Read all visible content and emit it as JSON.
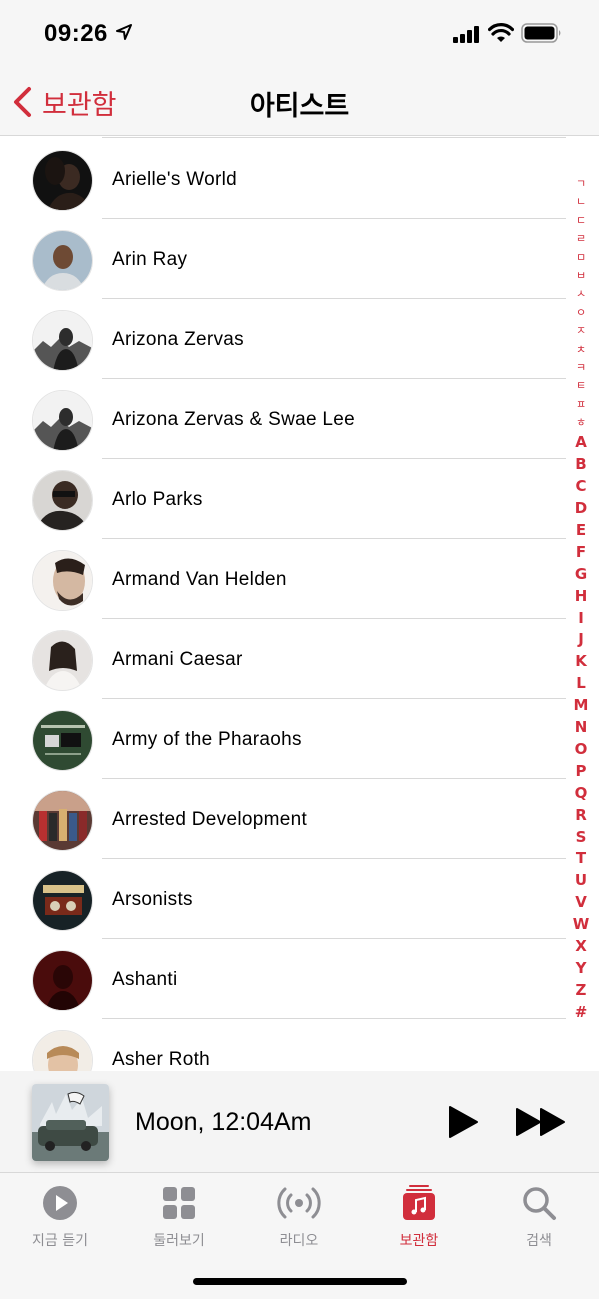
{
  "status": {
    "time": "09:26"
  },
  "nav": {
    "back_label": "보관함",
    "title": "아티스트"
  },
  "artists": [
    {
      "name": "Arielle's World",
      "avatar_color": "#2a2420"
    },
    {
      "name": "Arin Ray",
      "avatar_color": "#9fb3c4"
    },
    {
      "name": "Arizona Zervas",
      "avatar_color": "#6c6c6c"
    },
    {
      "name": "Arizona Zervas & Swae Lee",
      "avatar_color": "#6c6c6c"
    },
    {
      "name": "Arlo Parks",
      "avatar_color": "#3a3633"
    },
    {
      "name": "Armand Van Helden",
      "avatar_color": "#cfc6bd"
    },
    {
      "name": "Armani Caesar",
      "avatar_color": "#d9d4d0"
    },
    {
      "name": "Army of the Pharaohs",
      "avatar_color": "#2d4a30"
    },
    {
      "name": "Arrested Development",
      "avatar_color": "#7a4a3a"
    },
    {
      "name": "Arsonists",
      "avatar_color": "#1f2a2c"
    },
    {
      "name": "Ashanti",
      "avatar_color": "#5a0d0d"
    },
    {
      "name": "Asher Roth",
      "avatar_color": "#e8d8c6"
    }
  ],
  "index": {
    "korean": [
      "ㄱ",
      "ㄴ",
      "ㄷ",
      "ㄹ",
      "ㅁ",
      "ㅂ",
      "ㅅ",
      "ㅇ",
      "ㅈ",
      "ㅊ",
      "ㅋ",
      "ㅌ",
      "ㅍ",
      "ㅎ"
    ],
    "latin": [
      "A",
      "B",
      "C",
      "D",
      "E",
      "F",
      "G",
      "H",
      "I",
      "J",
      "K",
      "L",
      "M",
      "N",
      "O",
      "P",
      "Q",
      "R",
      "S",
      "T",
      "U",
      "V",
      "W",
      "X",
      "Y",
      "Z",
      "#"
    ]
  },
  "now_playing": {
    "title": "Moon, 12:04Am",
    "play_icon": "play-icon",
    "next_icon": "fast-forward-icon"
  },
  "tabs": [
    {
      "label": "지금 듣기",
      "icon": "play-circle-icon",
      "active": false
    },
    {
      "label": "둘러보기",
      "icon": "grid-icon",
      "active": false
    },
    {
      "label": "라디오",
      "icon": "radio-waves-icon",
      "active": false
    },
    {
      "label": "보관함",
      "icon": "music-library-icon",
      "active": true
    },
    {
      "label": "검색",
      "icon": "search-icon",
      "active": false
    }
  ],
  "colors": {
    "accent": "#d12e3c",
    "inactive": "#8e8e93"
  }
}
